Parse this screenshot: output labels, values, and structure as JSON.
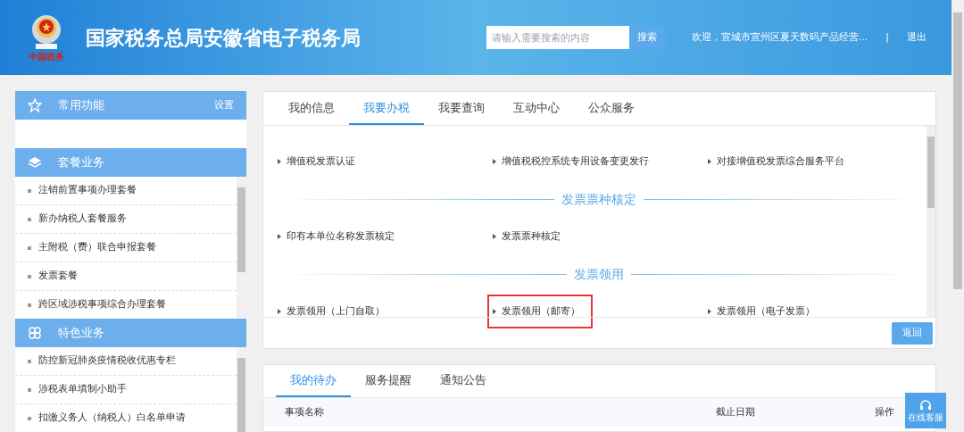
{
  "header": {
    "logo_text": "中国税务",
    "title": "国家税务总局安徽省电子税务局",
    "search": {
      "placeholder": "请输入需要搜索的内容",
      "button": "搜索"
    },
    "welcome": "欢迎，宣城市宣州区夏天数码产品经营...",
    "separator": "|",
    "logout": "退出"
  },
  "sidebar": {
    "sections": [
      {
        "kind": "star",
        "title": "常用功能",
        "action": "设置"
      },
      {
        "kind": "layers",
        "title": "套餐业务",
        "items": [
          "注销前置事项办理套餐",
          "新办纳税人套餐服务",
          "主附税（费）联合申报套餐",
          "发票套餐",
          "跨区域涉税事项综合办理套餐"
        ]
      },
      {
        "kind": "clover",
        "title": "特色业务",
        "items": [
          "防控新冠肺炎疫情税收优惠专栏",
          "涉税表单填制小助手",
          "扣缴义务人（纳税人）白名单申请"
        ]
      }
    ]
  },
  "main": {
    "tabs": [
      {
        "label": "我的信息",
        "selected": false
      },
      {
        "label": "我要办税",
        "selected": true
      },
      {
        "label": "我要查询",
        "selected": false
      },
      {
        "label": "互动中心",
        "selected": false
      },
      {
        "label": "公众服务",
        "selected": false
      }
    ],
    "groups": [
      {
        "items": [
          {
            "label": "增值税发票认证",
            "highlighted": false
          },
          {
            "label": "增值税税控系统专用设备变更发行",
            "highlighted": false
          },
          {
            "label": "对接增值税发票综合服务平台",
            "highlighted": false
          }
        ]
      },
      {
        "heading": "发票票种核定",
        "items": [
          {
            "label": "印有本单位名称发票核定",
            "highlighted": false
          },
          {
            "label": "发票票种核定",
            "highlighted": false
          }
        ]
      },
      {
        "heading": "发票领用",
        "items": [
          {
            "label": "发票领用（上门自取）",
            "highlighted": false
          },
          {
            "label": "发票领用（邮寄）",
            "highlighted": true
          },
          {
            "label": "发票领用（电子发票）",
            "highlighted": false
          }
        ]
      }
    ],
    "back_button": "返回"
  },
  "todo": {
    "tabs": [
      {
        "label": "我的待办",
        "selected": true
      },
      {
        "label": "服务提醒",
        "selected": false
      },
      {
        "label": "通知公告",
        "selected": false
      }
    ],
    "columns": [
      "事项名称",
      "截止日期",
      "操作"
    ]
  },
  "chat_button": "在线客服"
}
